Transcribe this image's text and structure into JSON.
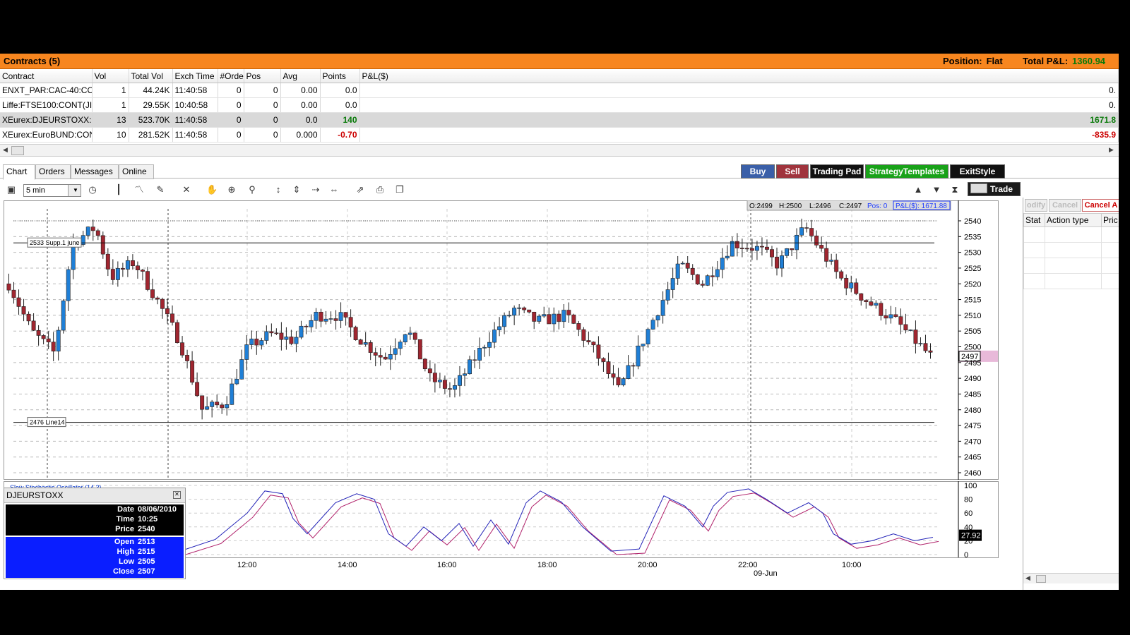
{
  "contracts": {
    "title": "Contracts (5)",
    "position_label": "Position:",
    "position_value": "Flat",
    "total_pnl_label": "Total P&L:",
    "total_pnl_value": "1360.94",
    "columns": [
      "Contract",
      "Vol",
      "Total Vol",
      "Exch Time",
      "#Orde",
      "Pos",
      "Avg",
      "Points",
      "P&L($)"
    ],
    "rows": [
      {
        "contract": "ENXT_PAR:CAC-40:CO",
        "vol": "1",
        "total_vol": "44.24K",
        "exch_time": "11:40:58",
        "orders": "0",
        "pos": "0",
        "avg": "0.00",
        "points": "0.0",
        "points_class": "",
        "pnl": "0.",
        "pnl_class": ""
      },
      {
        "contract": "Liffe:FTSE100:CONT(JI",
        "vol": "1",
        "total_vol": "29.55K",
        "exch_time": "10:40:58",
        "orders": "0",
        "pos": "0",
        "avg": "0.00",
        "points": "0.0",
        "points_class": "",
        "pnl": "0.",
        "pnl_class": ""
      },
      {
        "contract": "XEurex:DJEURSTOXX:(",
        "vol": "13",
        "total_vol": "523.70K",
        "exch_time": "11:40:58",
        "orders": "0",
        "pos": "0",
        "avg": "0.0",
        "points": "140",
        "points_class": "green",
        "pnl": "1671.8",
        "pnl_class": "green"
      },
      {
        "contract": "XEurex:EuroBUND:CON",
        "vol": "10",
        "total_vol": "281.52K",
        "exch_time": "11:40:58",
        "orders": "0",
        "pos": "0",
        "avg": "0.000",
        "points": "-0.70",
        "points_class": "red",
        "pnl": "-835.9",
        "pnl_class": "red"
      }
    ]
  },
  "tabs": [
    {
      "label": "Chart",
      "active": true
    },
    {
      "label": "Orders",
      "active": false
    },
    {
      "label": "Messages",
      "active": false
    },
    {
      "label": "Online",
      "active": false
    }
  ],
  "trade_buttons": {
    "buy": "Buy",
    "sell": "Sell",
    "trading_pad": "Trading Pad",
    "strategy_templates": "StrategyTemplates",
    "exit_style": "ExitStyle",
    "trade": "Trade"
  },
  "colors": {
    "buy": "#3a5fa8",
    "sell": "#a0343d",
    "strategy": "#18a218",
    "header": "#f7861f",
    "up_candle": "#1f7fd6",
    "down_candle": "#a02630"
  },
  "toolbar": {
    "interval": "5 min",
    "icons": [
      "chart-settings-icon",
      "clock-icon",
      "bar-type-icon",
      "indicator-icon",
      "draw-tool-icon",
      "erase-tool-icon",
      "hand-icon",
      "zoom-area-icon",
      "zoom-icon",
      "scale-vertical-icon",
      "scale-vertical-2-icon",
      "shrink-horizontal-icon",
      "expand-horizontal-icon",
      "export-icon",
      "print-icon",
      "copy-icon"
    ]
  },
  "chart": {
    "ohlc_bar": {
      "o": "O:2499",
      "h": "H:2500",
      "l": "L:2496",
      "c": "C:2497",
      "pos": "Pos: 0",
      "pnl": "P&L($): 1671.88"
    },
    "price_ticks": [
      "2540",
      "2535",
      "2530",
      "2525",
      "2520",
      "2515",
      "2510",
      "2505",
      "2500",
      "2495",
      "2490",
      "2485",
      "2480",
      "2475",
      "2470",
      "2465",
      "2460"
    ],
    "current_price": "2497",
    "supp_label": "2533 Supp.1 june",
    "line14_label": "2476 Line14",
    "time_ticks": [
      "12:00",
      "14:00",
      "16:00",
      "18:00",
      "20:00",
      "22:00",
      "10:00"
    ],
    "date_label": "09-Jun",
    "stoch_ticks": [
      "100",
      "80",
      "60",
      "40",
      "20",
      "0"
    ],
    "stoch_value": "27.92",
    "stoch_label": "Slow Stochastic Oscillator (14,3)"
  },
  "chart_data": {
    "type": "candlestick",
    "ylim": [
      2460,
      2540
    ],
    "bars_count": 187,
    "levels": [
      2533,
      2476
    ],
    "last_close": 2497,
    "stochastic_last": 27.92
  },
  "info": {
    "title": "DJEURSTOXX",
    "date_label": "Date",
    "date": "08/06/2010",
    "time_label": "Time",
    "time": "10:25",
    "price_label": "Price",
    "price": "2540",
    "open_label": "Open",
    "open": "2513",
    "high_label": "High",
    "high": "2515",
    "low_label": "Low",
    "low": "2505",
    "close_label": "Close",
    "close": "2507"
  },
  "orders_panel": {
    "modify": "odify",
    "cancel": "Cancel",
    "cancel_all": "Cancel A",
    "columns": [
      "Stat",
      "Action type",
      "Pric"
    ]
  }
}
